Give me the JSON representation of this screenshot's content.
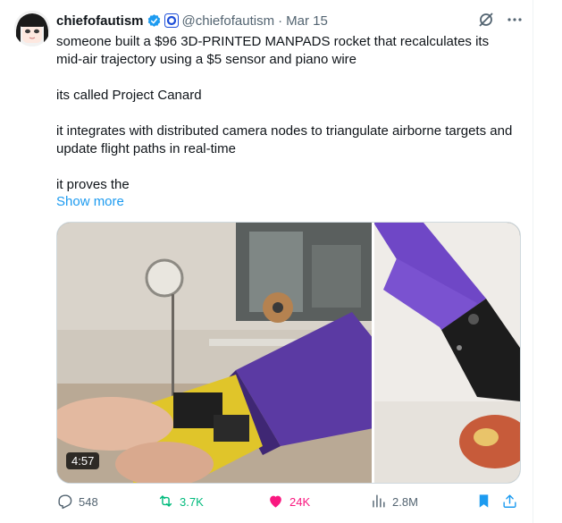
{
  "author": {
    "name": "chiefofautism",
    "handle": "@chiefofautism",
    "date": "Mar 15"
  },
  "body": {
    "p1": "someone built a $96 3D-PRINTED MANPADS rocket that recalculates its mid-air trajectory using a $5 sensor and piano wire",
    "p2": "its called Project Canard",
    "p3": "it integrates with distributed camera nodes to triangulate airborne targets and update flight paths in real-time",
    "p4": "it proves the",
    "show_more": "Show more"
  },
  "media": {
    "duration": "4:57"
  },
  "actions": {
    "replies": "548",
    "reposts": "3.7K",
    "likes": "24K",
    "views": "2.8M"
  },
  "colors": {
    "link": "#1d9bf0",
    "muted": "#536471",
    "repost": "#00ba7c",
    "like": "#f91880",
    "verified": "#1d9bf0"
  },
  "icons": [
    "verified-badge-icon",
    "affiliate-badge-icon",
    "grok-icon",
    "more-icon",
    "reply-icon",
    "repost-icon",
    "like-icon",
    "views-icon",
    "bookmark-icon",
    "share-icon"
  ]
}
